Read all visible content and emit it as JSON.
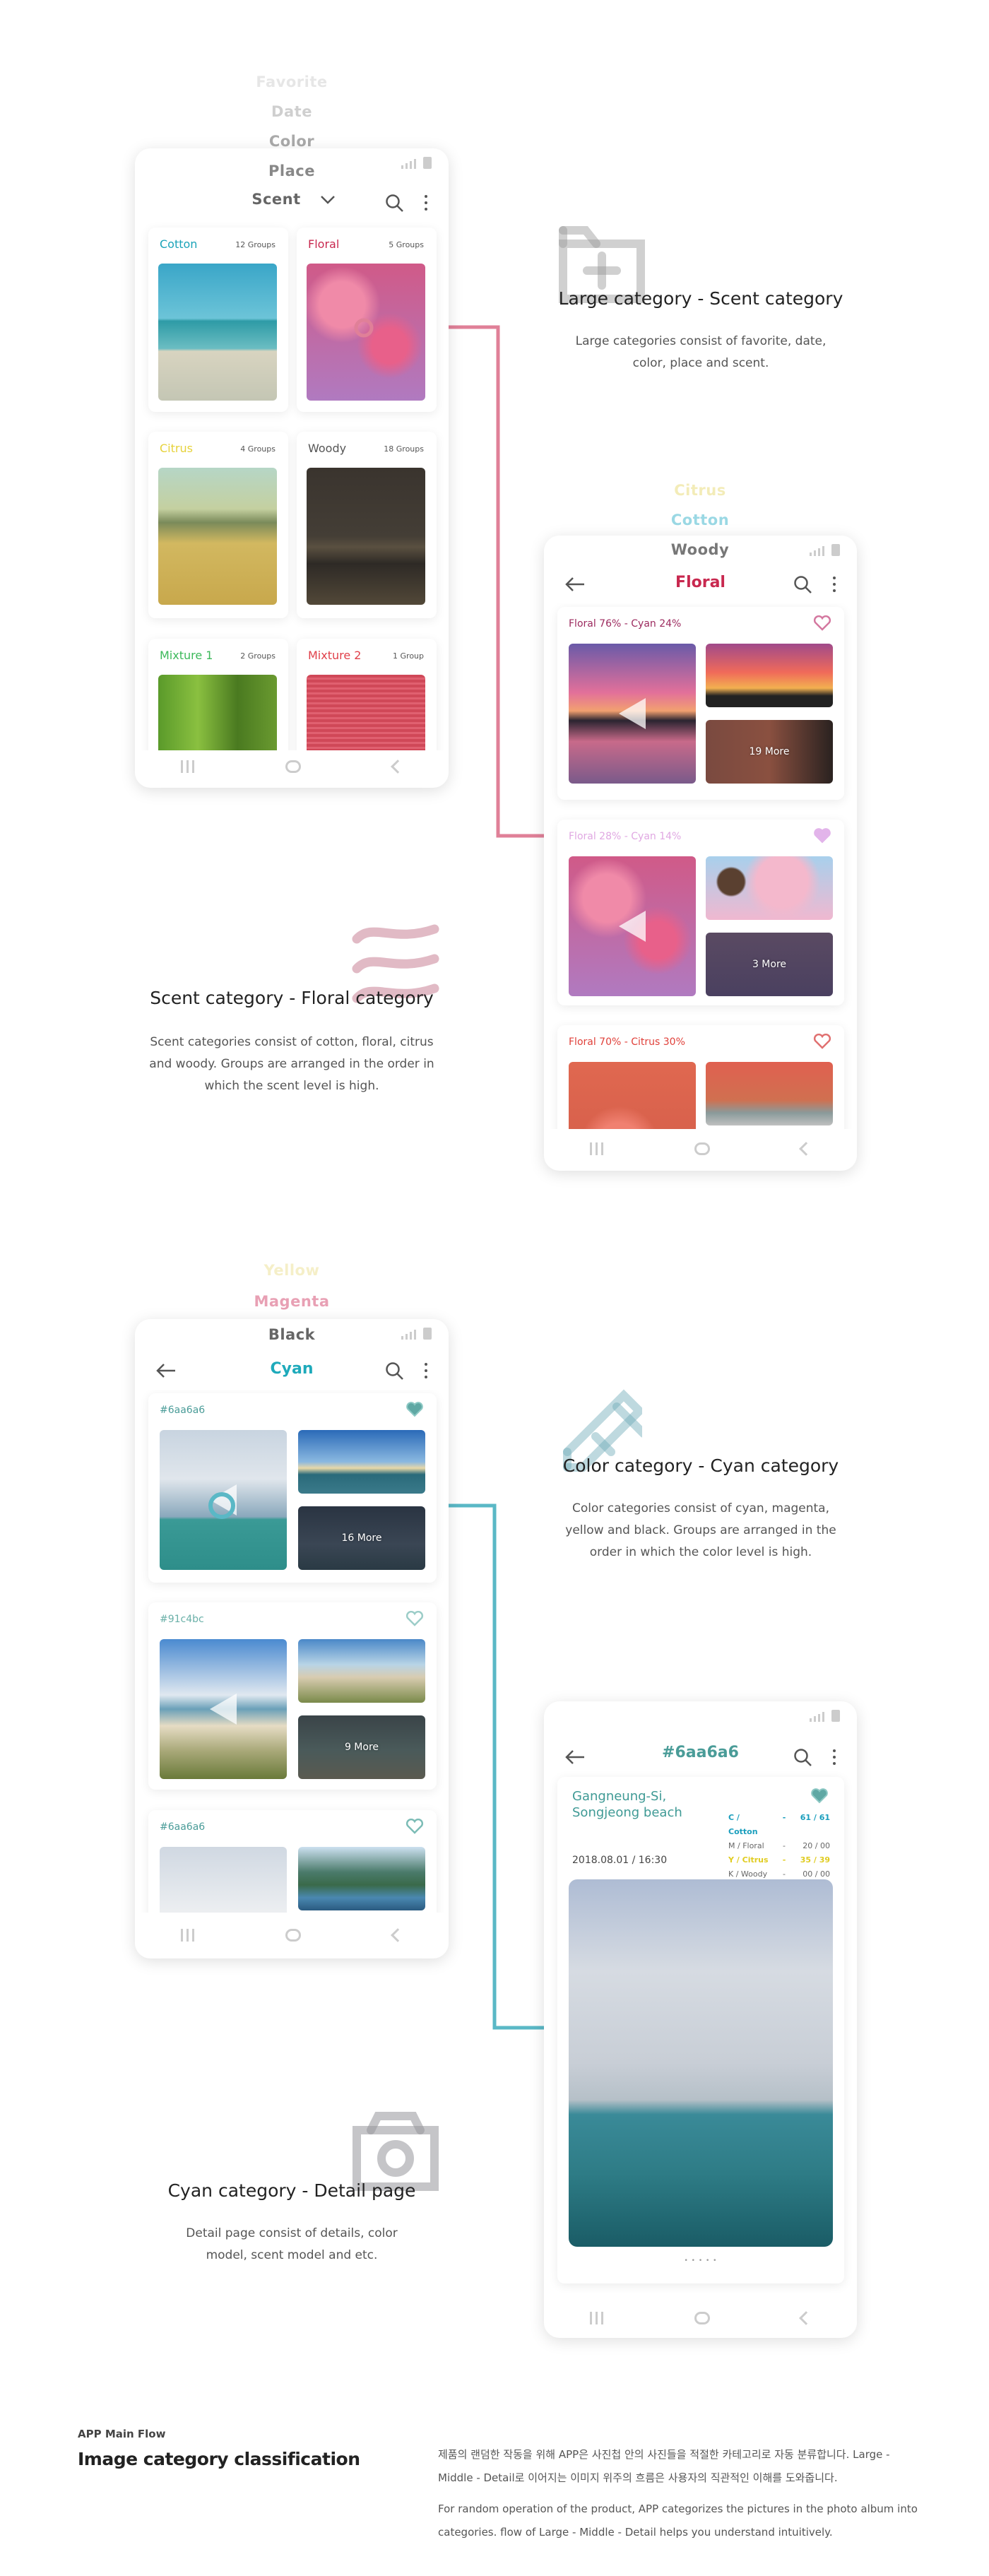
{
  "colors": {
    "floral": "#c8284f",
    "cyan": "#1eaabb",
    "teal": "#4a9c98",
    "connector_floral": "#e08098",
    "connector_cyan": "#5ab8c6"
  },
  "large": {
    "picker": [
      "Favorite",
      "Date",
      "Color",
      "Place"
    ],
    "selected": "Scent",
    "cards": [
      {
        "name": "Cotton",
        "count": "12 Groups",
        "color": "#1aa3b8"
      },
      {
        "name": "Floral",
        "count": "5 Groups",
        "color": "#c8284f"
      },
      {
        "name": "Citrus",
        "count": "4 Groups",
        "color": "#e6d23a"
      },
      {
        "name": "Woody",
        "count": "18 Groups",
        "color": "#555555"
      },
      {
        "name": "Mixture 1",
        "count": "2 Groups",
        "color": "#3cb95a"
      },
      {
        "name": "Mixture 2",
        "count": "1 Group",
        "color": "#e0404a"
      }
    ],
    "desc_title": "Large category - Scent category",
    "desc_body": "Large categories consist of favorite, date, color, place and scent."
  },
  "floral": {
    "picker": [
      "Citrus",
      "Cotton",
      "Woody"
    ],
    "title": "Floral",
    "groups": [
      {
        "label": "Floral 76% - Cyan 24%",
        "more": "19 More",
        "favorited": false
      },
      {
        "label": "Floral 28% - Cyan 14%",
        "more": "3 More",
        "favorited": true
      },
      {
        "label": "Floral 70% - Citrus 30%",
        "favorited": false
      }
    ],
    "desc_title": "Scent category - Floral category",
    "desc_body": "Scent categories consist of cotton, floral, citrus and woody. Groups are arranged in the order in which the scent level is high."
  },
  "cyan": {
    "picker": [
      "Yellow",
      "Magenta",
      "Black"
    ],
    "title": "Cyan",
    "groups": [
      {
        "label": "#6aa6a6",
        "more": "16 More",
        "favorited": true
      },
      {
        "label": "#91c4bc",
        "more": "9 More",
        "favorited": false
      },
      {
        "label": "#6aa6a6",
        "favorited": false
      }
    ],
    "desc_title": "Color category - Cyan category",
    "desc_body": "Color categories consist of cyan, magenta, yellow and black.  Groups are arranged in the order in which the color level is high."
  },
  "detail": {
    "title": "#6aa6a6",
    "place": "Gangneung-Si, Songjeong beach",
    "datetime": "2018.08.01 / 16:30",
    "favorited": true,
    "model": [
      {
        "key": "C / Cotton",
        "sep": "-",
        "value": "61 / 61"
      },
      {
        "key": "M / Floral",
        "sep": "-",
        "value": "20 / 00"
      },
      {
        "key": "Y / Citrus",
        "sep": "-",
        "value": "35 / 39"
      },
      {
        "key": "K / Woody",
        "sep": "-",
        "value": "00 / 00"
      }
    ],
    "pager": "• • • • •",
    "desc_title": "Cyan category - Detail page",
    "desc_body": "Detail page consist of details, color model, scent model and etc."
  },
  "footer": {
    "eyebrow": "APP Main Flow",
    "title": "Image category classification",
    "body_ko": "제품의 랜덤한 작동을 위해 APP은 사진첩 안의 사진들을 적절한 카테고리로 자동 분류합니다. Large - Middle - Detail로 이어지는 이미지 위주의 흐름은 사용자의 직관적인 이해를 도와줍니다.",
    "body_en": "For random operation of the product, APP categorizes the pictures in the photo album into categories. flow of Large - Middle - Detail helps you understand intuitively."
  }
}
